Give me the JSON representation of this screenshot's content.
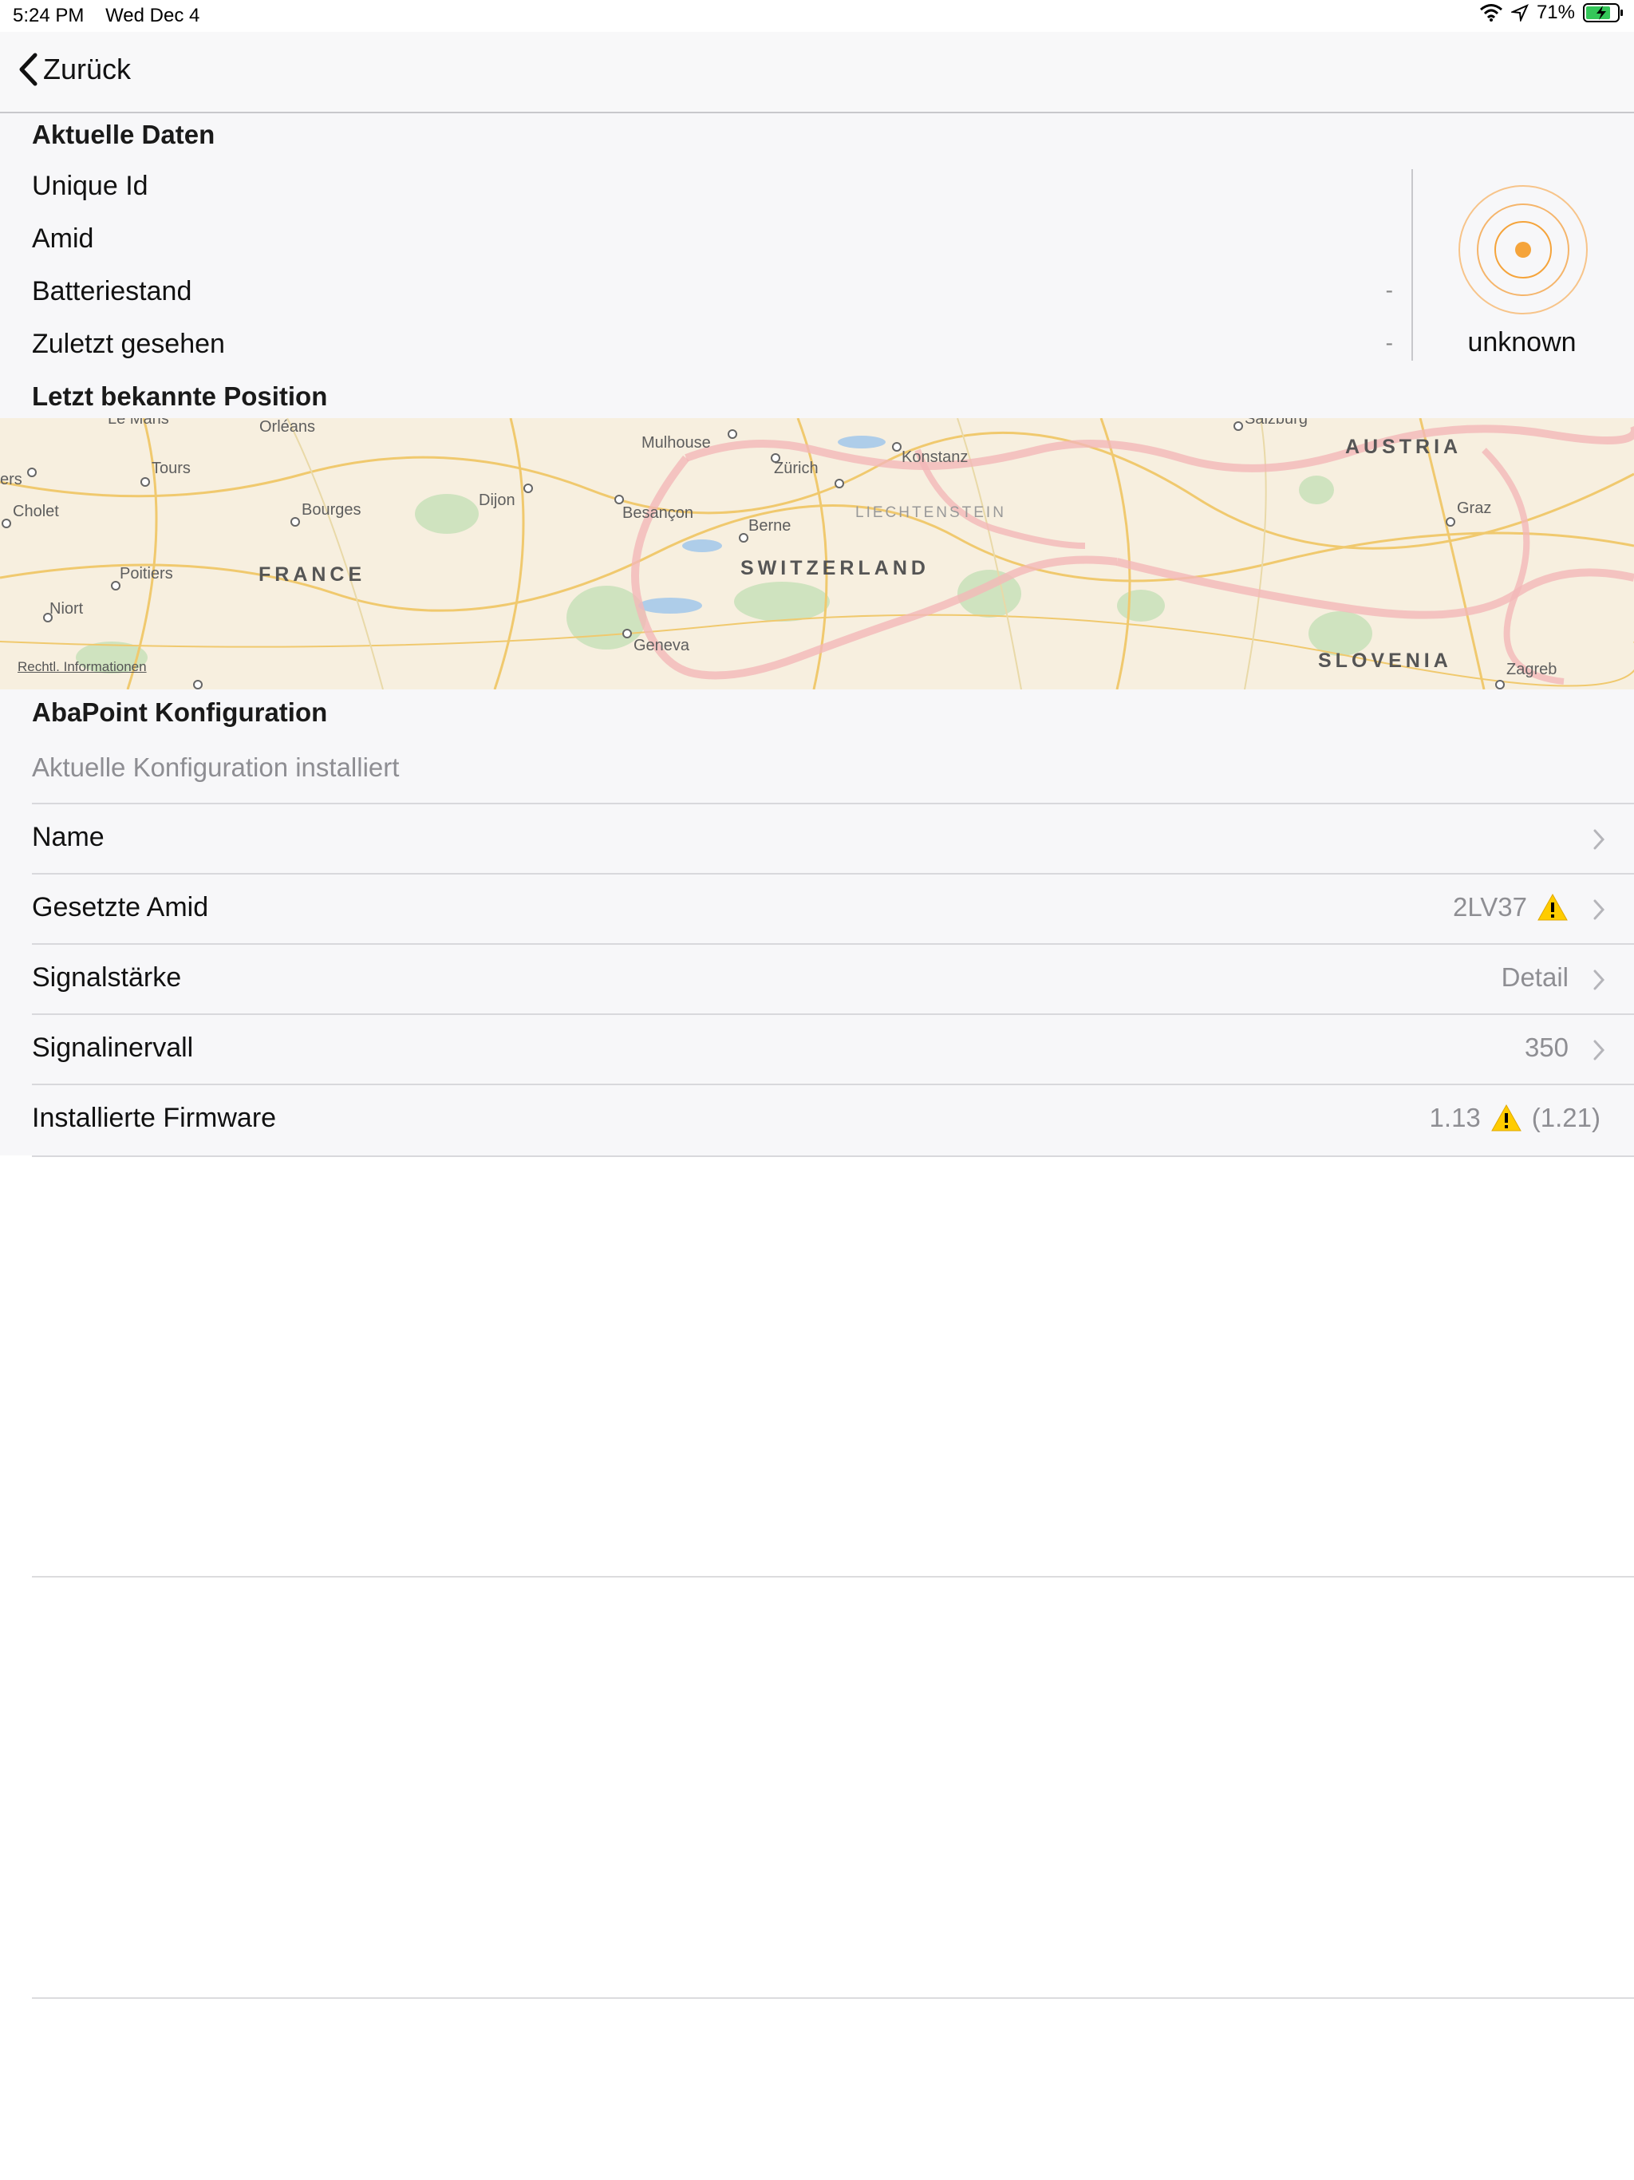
{
  "status_bar": {
    "time": "5:24 PM",
    "date": "Wed Dec 4",
    "battery": "71%"
  },
  "nav": {
    "back_label": "Zurück"
  },
  "current_data": {
    "header": "Aktuelle Daten",
    "rows": [
      {
        "label": "Unique Id",
        "value": ""
      },
      {
        "label": "Amid",
        "value": ""
      },
      {
        "label": "Batteriestand",
        "value": "-"
      },
      {
        "label": "Zuletzt gesehen",
        "value": "-"
      }
    ],
    "beacon_status": "unknown"
  },
  "position": {
    "header": "Letzt bekannte Position",
    "legal_link": "Rechtl. Informationen",
    "labels": {
      "le_mans": "Le Mans",
      "orleans": "Orléans",
      "tours": "Tours",
      "ers": "ers",
      "cholet": "Cholet",
      "bourges": "Bourges",
      "poitiers": "Poitiers",
      "niort": "Niort",
      "dijon": "Dijon",
      "besancon": "Besançon",
      "mulhouse": "Mulhouse",
      "zurich": "Zürich",
      "berne": "Berne",
      "geneva": "Geneva",
      "konstanz": "Konstanz",
      "salzburg": "Salzburg",
      "graz": "Graz",
      "zagreb": "Zagreb"
    },
    "countries": {
      "france": "FRANCE",
      "switzerland": "SWITZERLAND",
      "liechtenstein": "LIECHTENSTEIN",
      "austria": "AUSTRIA",
      "slovenia": "SLOVENIA"
    }
  },
  "config": {
    "header": "AbaPoint Konfiguration",
    "subtitle": "Aktuelle Konfiguration installiert",
    "rows": [
      {
        "label": "Name",
        "value": ""
      },
      {
        "label": "Gesetzte Amid",
        "value": "2LV37"
      },
      {
        "label": "Signalstärke",
        "value": "Detail"
      },
      {
        "label": "Signalinervall",
        "value": "350"
      },
      {
        "label": "Installierte Firmware",
        "value": "1.13",
        "value_extra": "(1.21)"
      }
    ]
  },
  "colors": {
    "accent": "#f5a43b",
    "warning": "#ffcc00"
  }
}
